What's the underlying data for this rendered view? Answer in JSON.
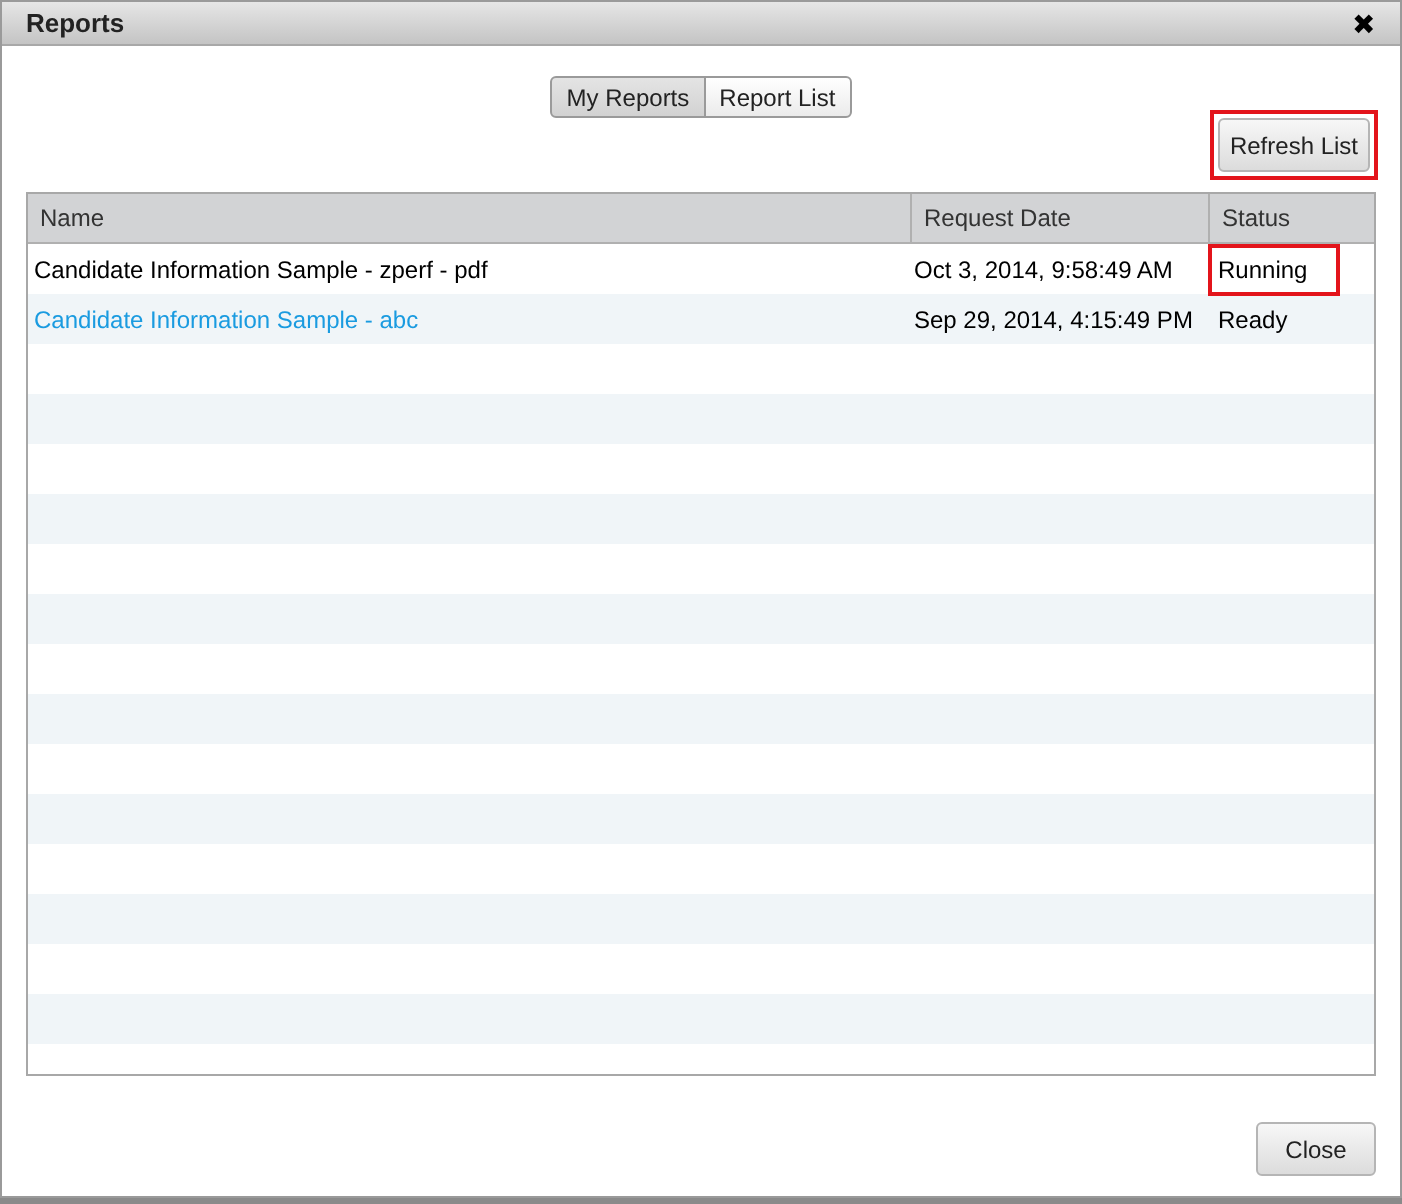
{
  "window": {
    "title": "Reports",
    "close": "✖"
  },
  "tabs": [
    {
      "label": "My Reports",
      "selected": true
    },
    {
      "label": "Report List",
      "selected": false
    }
  ],
  "refresh_button": {
    "label": "Refresh List",
    "highlighted": true
  },
  "table": {
    "columns": [
      "Name",
      "Request Date",
      "Status"
    ],
    "rows": [
      {
        "name": "Candidate Information Sample - zperf - pdf",
        "link": false,
        "request_date": "Oct 3, 2014, 9:58:49 AM",
        "status": "Running",
        "status_highlighted": true
      },
      {
        "name": "Candidate Information Sample - abc",
        "link": true,
        "request_date": "Sep 29, 2014, 4:15:49 PM",
        "status": "Ready",
        "status_highlighted": false
      }
    ]
  },
  "close_button": "Close"
}
